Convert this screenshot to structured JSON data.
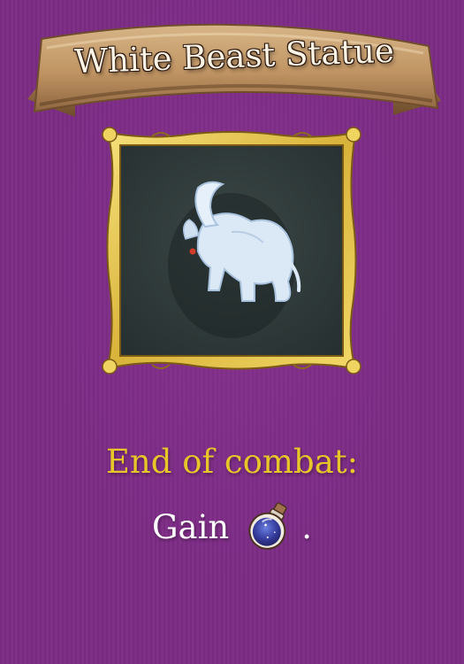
{
  "card": {
    "title": "White Beast Statue",
    "effect_trigger": "End of combat:",
    "effect_verb": "Gain",
    "effect_end": ".",
    "effect_icon": "mana-potion-icon",
    "portrait": "white-beast-statue-icon"
  },
  "colors": {
    "background": "#7b2b84",
    "banner": "#c39b6b",
    "frame_gold": "#e8c84a",
    "portrait_bg": "#2f3b3a",
    "trigger_text": "#e8c629",
    "body_text": "#ffffff"
  }
}
